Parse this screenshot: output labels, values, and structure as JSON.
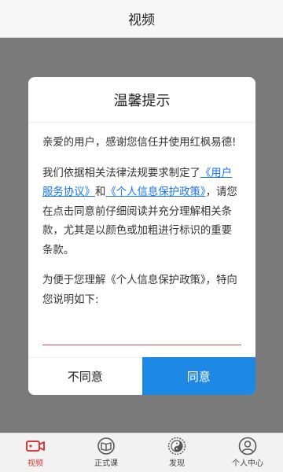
{
  "header": {
    "title": "视频"
  },
  "dialog": {
    "title": "温馨提示",
    "para1": "亲爱的用户，感谢您信任并使用红枫易德!",
    "para2_prefix": "我们依据相关法律法规要求制定了",
    "link_user_agreement": "《用户服务协议》",
    "para2_and": "和",
    "link_privacy": "《个人信息保护政策》",
    "para2_suffix": "，请您在点击同意前仔细阅读并充分理解相关条款，尤其是以颜色或加粗进行标识的重要条款。",
    "para3": "为便于您理解《个人信息保护政策》，特向您说明如下:",
    "disagree_label": "不同意",
    "agree_label": "同意"
  },
  "tabs": [
    {
      "label": "视频",
      "icon": "video-camera-icon",
      "active": true
    },
    {
      "label": "正式课",
      "icon": "book-icon",
      "active": false
    },
    {
      "label": "发现",
      "icon": "yin-yang-icon",
      "active": false
    },
    {
      "label": "个人中心",
      "icon": "user-icon",
      "active": false
    }
  ],
  "colors": {
    "accent": "#1e88e5",
    "active_tab": "#d23c3c",
    "link": "#1a73e8",
    "overlay": "#7a7a7a"
  }
}
